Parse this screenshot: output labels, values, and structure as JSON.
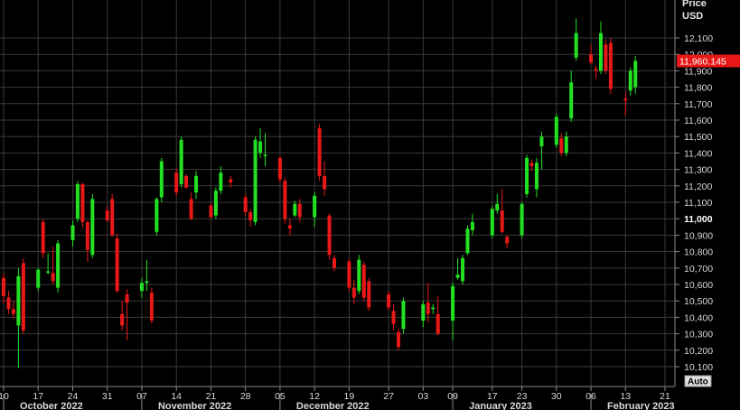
{
  "chart_data": {
    "type": "candlestick",
    "y_axis_title_line1": "Price",
    "y_axis_title_line2": "USD",
    "ylim": [
      10050,
      12250
    ],
    "y_ticks": [
      10100,
      10200,
      10300,
      10400,
      10500,
      10600,
      10700,
      10800,
      10900,
      11000,
      11100,
      11200,
      11300,
      11400,
      11500,
      11600,
      11700,
      11800,
      11900,
      12000,
      12100
    ],
    "y_tick_labels": [
      "10,100",
      "10,200",
      "10,300",
      "10,400",
      "10,500",
      "10,600",
      "10,700",
      "10,800",
      "10,900",
      "11,000",
      "11,100",
      "11,200",
      "11,300",
      "11,400",
      "11,500",
      "11,600",
      "11,700",
      "11,800",
      "11,900",
      "12,000",
      "12,100"
    ],
    "y_emphasized_tick": "11,000",
    "last_price_label": "11,960.145",
    "last_price": 11960,
    "x_range": [
      "2022-10-10",
      "2023-02-21"
    ],
    "x_ticks": [
      {
        "date": "2022-10-10",
        "label": "10"
      },
      {
        "date": "2022-10-17",
        "label": "17"
      },
      {
        "date": "2022-10-24",
        "label": "24"
      },
      {
        "date": "2022-10-31",
        "label": "31"
      },
      {
        "date": "2022-11-07",
        "label": "07"
      },
      {
        "date": "2022-11-14",
        "label": "14"
      },
      {
        "date": "2022-11-21",
        "label": "21"
      },
      {
        "date": "2022-11-28",
        "label": "28"
      },
      {
        "date": "2022-12-05",
        "label": "05"
      },
      {
        "date": "2022-12-12",
        "label": "12"
      },
      {
        "date": "2022-12-19",
        "label": "19"
      },
      {
        "date": "2022-12-27",
        "label": "27"
      },
      {
        "date": "2023-01-03",
        "label": "03"
      },
      {
        "date": "2023-01-09",
        "label": "09"
      },
      {
        "date": "2023-01-17",
        "label": "17"
      },
      {
        "date": "2023-01-23",
        "label": "23"
      },
      {
        "date": "2023-01-30",
        "label": "30"
      },
      {
        "date": "2023-02-06",
        "label": "06"
      },
      {
        "date": "2023-02-13",
        "label": "13"
      },
      {
        "date": "2023-02-21",
        "label": "21"
      }
    ],
    "month_labels": [
      {
        "date": "2022-10-10",
        "label": "October 2022"
      },
      {
        "date": "2022-11-07",
        "label": "November 2022"
      },
      {
        "date": "2022-12-05",
        "label": "December 2022"
      },
      {
        "date": "2023-01-09",
        "label": "January 2023"
      },
      {
        "date": "2023-02-06",
        "label": "February 2023"
      }
    ],
    "auto_label": "Auto",
    "colors": {
      "up": "#22e022",
      "down": "#e81818",
      "grid": "#3a3a3a",
      "background": "#000000",
      "price_tag": "#e81818"
    },
    "candles": [
      {
        "date": "2022-10-10",
        "open": 10640,
        "high": 10670,
        "low": 10480,
        "close": 10530
      },
      {
        "date": "2022-10-11",
        "open": 10520,
        "high": 10560,
        "low": 10420,
        "close": 10450
      },
      {
        "date": "2022-10-12",
        "open": 10450,
        "high": 10500,
        "low": 10390,
        "close": 10420
      },
      {
        "date": "2022-10-13",
        "open": 10350,
        "high": 10700,
        "low": 10090,
        "close": 10650
      },
      {
        "date": "2022-10-14",
        "open": 10730,
        "high": 10760,
        "low": 10300,
        "close": 10320
      },
      {
        "date": "2022-10-17",
        "open": 10580,
        "high": 10700,
        "low": 10560,
        "close": 10690
      },
      {
        "date": "2022-10-18",
        "open": 10980,
        "high": 11000,
        "low": 10760,
        "close": 10790
      },
      {
        "date": "2022-10-19",
        "open": 10680,
        "high": 10790,
        "low": 10660,
        "close": 10680
      },
      {
        "date": "2022-10-20",
        "open": 10670,
        "high": 10830,
        "low": 10600,
        "close": 10620
      },
      {
        "date": "2022-10-21",
        "open": 10580,
        "high": 10870,
        "low": 10550,
        "close": 10850
      },
      {
        "date": "2022-10-24",
        "open": 10870,
        "high": 10990,
        "low": 10830,
        "close": 10960
      },
      {
        "date": "2022-10-25",
        "open": 11000,
        "high": 11230,
        "low": 10980,
        "close": 11210
      },
      {
        "date": "2022-10-26",
        "open": 11210,
        "high": 11220,
        "low": 10950,
        "close": 10980
      },
      {
        "date": "2022-10-27",
        "open": 10980,
        "high": 10990,
        "low": 10740,
        "close": 10810
      },
      {
        "date": "2022-10-28",
        "open": 10780,
        "high": 11150,
        "low": 10760,
        "close": 11120
      },
      {
        "date": "2022-10-31",
        "open": 11050,
        "high": 11080,
        "low": 10980,
        "close": 10990
      },
      {
        "date": "2022-11-01",
        "open": 11120,
        "high": 11150,
        "low": 10890,
        "close": 10900
      },
      {
        "date": "2022-11-02",
        "open": 10880,
        "high": 10910,
        "low": 10550,
        "close": 10560
      },
      {
        "date": "2022-11-03",
        "open": 10420,
        "high": 10500,
        "low": 10320,
        "close": 10350
      },
      {
        "date": "2022-11-04",
        "open": 10540,
        "high": 10570,
        "low": 10260,
        "close": 10490
      },
      {
        "date": "2022-11-07",
        "open": 10560,
        "high": 10640,
        "low": 10520,
        "close": 10610
      },
      {
        "date": "2022-11-08",
        "open": 10610,
        "high": 10750,
        "low": 10560,
        "close": 10620
      },
      {
        "date": "2022-11-09",
        "open": 10550,
        "high": 10580,
        "low": 10360,
        "close": 10380
      },
      {
        "date": "2022-11-10",
        "open": 10920,
        "high": 11130,
        "low": 10900,
        "close": 11120
      },
      {
        "date": "2022-11-11",
        "open": 11130,
        "high": 11370,
        "low": 11100,
        "close": 11350
      },
      {
        "date": "2022-11-14",
        "open": 11280,
        "high": 11310,
        "low": 11140,
        "close": 11160
      },
      {
        "date": "2022-11-15",
        "open": 11210,
        "high": 11500,
        "low": 11190,
        "close": 11480
      },
      {
        "date": "2022-11-16",
        "open": 11260,
        "high": 11270,
        "low": 11180,
        "close": 11190
      },
      {
        "date": "2022-11-17",
        "open": 11120,
        "high": 11160,
        "low": 10990,
        "close": 11000
      },
      {
        "date": "2022-11-18",
        "open": 11160,
        "high": 11290,
        "low": 11120,
        "close": 11260
      },
      {
        "date": "2022-11-21",
        "open": 11080,
        "high": 11100,
        "low": 11000,
        "close": 11010
      },
      {
        "date": "2022-11-22",
        "open": 11020,
        "high": 11190,
        "low": 11000,
        "close": 11170
      },
      {
        "date": "2022-11-23",
        "open": 11170,
        "high": 11320,
        "low": 11150,
        "close": 11280
      },
      {
        "date": "2022-11-25",
        "open": 11240,
        "high": 11260,
        "low": 11190,
        "close": 11220
      },
      {
        "date": "2022-11-28",
        "open": 11130,
        "high": 11150,
        "low": 11020,
        "close": 11040
      },
      {
        "date": "2022-11-29",
        "open": 11040,
        "high": 11060,
        "low": 10950,
        "close": 10990
      },
      {
        "date": "2022-11-30",
        "open": 10980,
        "high": 11500,
        "low": 10960,
        "close": 11480
      },
      {
        "date": "2022-12-01",
        "open": 11400,
        "high": 11550,
        "low": 11370,
        "close": 11470
      },
      {
        "date": "2022-12-02",
        "open": 11390,
        "high": 11520,
        "low": 11320,
        "close": 11390
      },
      {
        "date": "2022-12-05",
        "open": 11370,
        "high": 11380,
        "low": 11220,
        "close": 11240
      },
      {
        "date": "2022-12-06",
        "open": 11230,
        "high": 11250,
        "low": 10970,
        "close": 11000
      },
      {
        "date": "2022-12-07",
        "open": 10960,
        "high": 11000,
        "low": 10900,
        "close": 10940
      },
      {
        "date": "2022-12-08",
        "open": 11020,
        "high": 11110,
        "low": 11010,
        "close": 11090
      },
      {
        "date": "2022-12-09",
        "open": 11090,
        "high": 11120,
        "low": 10980,
        "close": 11010
      },
      {
        "date": "2022-12-12",
        "open": 11010,
        "high": 11160,
        "low": 10950,
        "close": 11140
      },
      {
        "date": "2022-12-13",
        "open": 11550,
        "high": 11580,
        "low": 11230,
        "close": 11260
      },
      {
        "date": "2022-12-14",
        "open": 11260,
        "high": 11350,
        "low": 11140,
        "close": 11180
      },
      {
        "date": "2022-12-15",
        "open": 11020,
        "high": 11030,
        "low": 10750,
        "close": 10780
      },
      {
        "date": "2022-12-16",
        "open": 10760,
        "high": 10780,
        "low": 10680,
        "close": 10700
      },
      {
        "date": "2022-12-19",
        "open": 10740,
        "high": 10760,
        "low": 10560,
        "close": 10580
      },
      {
        "date": "2022-12-20",
        "open": 10580,
        "high": 10630,
        "low": 10480,
        "close": 10520
      },
      {
        "date": "2022-12-21",
        "open": 10560,
        "high": 10780,
        "low": 10540,
        "close": 10750
      },
      {
        "date": "2022-12-22",
        "open": 10720,
        "high": 10740,
        "low": 10500,
        "close": 10520
      },
      {
        "date": "2022-12-23",
        "open": 10620,
        "high": 10640,
        "low": 10440,
        "close": 10460
      },
      {
        "date": "2022-12-27",
        "open": 10540,
        "high": 10560,
        "low": 10440,
        "close": 10460
      },
      {
        "date": "2022-12-28",
        "open": 10440,
        "high": 10480,
        "low": 10320,
        "close": 10360
      },
      {
        "date": "2022-12-29",
        "open": 10310,
        "high": 10330,
        "low": 10200,
        "close": 10220
      },
      {
        "date": "2022-12-30",
        "open": 10330,
        "high": 10520,
        "low": 10300,
        "close": 10500
      },
      {
        "date": "2023-01-03",
        "open": 10380,
        "high": 10500,
        "low": 10340,
        "close": 10480
      },
      {
        "date": "2023-01-04",
        "open": 10490,
        "high": 10610,
        "low": 10370,
        "close": 10420
      },
      {
        "date": "2023-01-05",
        "open": 10450,
        "high": 10480,
        "low": 10420,
        "close": 10460
      },
      {
        "date": "2023-01-06",
        "open": 10420,
        "high": 10530,
        "low": 10290,
        "close": 10300
      },
      {
        "date": "2023-01-09",
        "open": 10380,
        "high": 10610,
        "low": 10260,
        "close": 10590
      },
      {
        "date": "2023-01-10",
        "open": 10640,
        "high": 10760,
        "low": 10630,
        "close": 10660
      },
      {
        "date": "2023-01-11",
        "open": 10620,
        "high": 10780,
        "low": 10600,
        "close": 10760
      },
      {
        "date": "2023-01-12",
        "open": 10790,
        "high": 10960,
        "low": 10780,
        "close": 10940
      },
      {
        "date": "2023-01-13",
        "open": 10930,
        "high": 11030,
        "low": 10900,
        "close": 10980
      },
      {
        "date": "2023-01-17",
        "open": 10900,
        "high": 11080,
        "low": 10880,
        "close": 11060
      },
      {
        "date": "2023-01-18",
        "open": 11050,
        "high": 11150,
        "low": 11030,
        "close": 11090
      },
      {
        "date": "2023-01-19",
        "open": 11050,
        "high": 11180,
        "low": 10910,
        "close": 10920
      },
      {
        "date": "2023-01-20",
        "open": 10890,
        "high": 10900,
        "low": 10820,
        "close": 10850
      },
      {
        "date": "2023-01-23",
        "open": 10900,
        "high": 11100,
        "low": 10880,
        "close": 11090
      },
      {
        "date": "2023-01-24",
        "open": 11150,
        "high": 11390,
        "low": 11130,
        "close": 11370
      },
      {
        "date": "2023-01-25",
        "open": 11340,
        "high": 11360,
        "low": 11290,
        "close": 11320
      },
      {
        "date": "2023-01-26",
        "open": 11180,
        "high": 11370,
        "low": 11130,
        "close": 11340
      },
      {
        "date": "2023-01-27",
        "open": 11440,
        "high": 11530,
        "low": 11300,
        "close": 11500
      },
      {
        "date": "2023-01-30",
        "open": 11450,
        "high": 11640,
        "low": 11430,
        "close": 11620
      },
      {
        "date": "2023-01-31",
        "open": 11490,
        "high": 11520,
        "low": 11380,
        "close": 11400
      },
      {
        "date": "2023-02-01",
        "open": 11400,
        "high": 11530,
        "low": 11380,
        "close": 11500
      },
      {
        "date": "2023-02-02",
        "open": 11610,
        "high": 11900,
        "low": 11590,
        "close": 11830
      },
      {
        "date": "2023-02-03",
        "open": 11980,
        "high": 12220,
        "low": 11960,
        "close": 12130
      },
      {
        "date": "2023-02-06",
        "open": 12000,
        "high": 12060,
        "low": 11940,
        "close": 11950
      },
      {
        "date": "2023-02-07",
        "open": 11910,
        "high": 11930,
        "low": 11850,
        "close": 11900
      },
      {
        "date": "2023-02-08",
        "open": 11900,
        "high": 12200,
        "low": 11880,
        "close": 12130
      },
      {
        "date": "2023-02-09",
        "open": 12060,
        "high": 12090,
        "low": 11880,
        "close": 11900
      },
      {
        "date": "2023-02-10",
        "open": 12070,
        "high": 12100,
        "low": 11760,
        "close": 11790
      },
      {
        "date": "2023-02-13",
        "open": 11730,
        "high": 11770,
        "low": 11630,
        "close": 11720
      },
      {
        "date": "2023-02-14",
        "open": 11780,
        "high": 11920,
        "low": 11750,
        "close": 11900
      },
      {
        "date": "2023-02-15",
        "open": 11800,
        "high": 11990,
        "low": 11760,
        "close": 11960
      }
    ]
  }
}
